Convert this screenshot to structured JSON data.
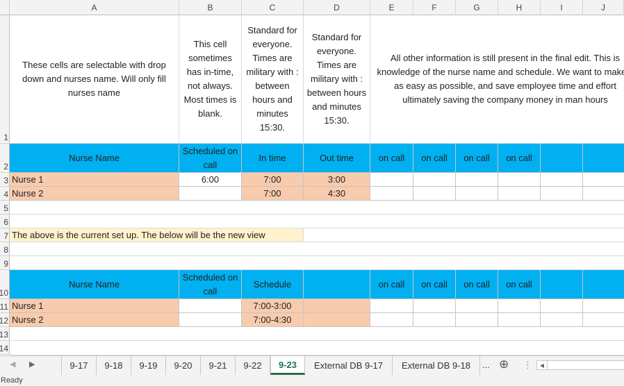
{
  "columns": [
    "A",
    "B",
    "C",
    "D",
    "E",
    "F",
    "G",
    "H",
    "I",
    "J"
  ],
  "rows": [
    "1",
    "2",
    "3",
    "4",
    "5",
    "6",
    "7",
    "8",
    "9",
    "10",
    "11",
    "12",
    "13",
    "14"
  ],
  "cells": {
    "a1": "These cells are selectable with drop down and nurses name. Will only fill nurses name",
    "b1": "This cell sometimes has in-time, not always. Most times is blank.",
    "c1": "Standard for everyone. Times are military with : between hours and minutes 15:30.",
    "d1": "Standard for everyone. Times are military with : between hours and minutes 15:30.",
    "e1": "All other information is still present in the final edit. This is knowledge of the nurse name and schedule. We want to make it as easy as possible, and save employee time and effort ultimately saving the company money in man hours",
    "a2": "Nurse Name",
    "b2": "Scheduled on call",
    "c2": "In time",
    "d2": "Out time",
    "e2": "on call",
    "f2": "on call",
    "g2": "on call",
    "h2": "on call",
    "a3": "Nurse 1",
    "b3": "6:00",
    "c3": "7:00",
    "d3": "3:00",
    "a4": "Nurse 2",
    "c4": "7:00",
    "d4": "4:30",
    "a7": "The above is the current set up. The below will be the new view",
    "a10": "Nurse Name",
    "b10": "Scheduled on call",
    "c10": "Schedule",
    "e10": "on call",
    "f10": "on call",
    "g10": "on call",
    "h10": "on call",
    "a11": "Nurse 1",
    "c11": "7:00-3:00",
    "a12": "Nurse 2",
    "c12": "7:00-4:30"
  },
  "tabs": [
    "9-17",
    "9-18",
    "9-19",
    "9-20",
    "9-21",
    "9-22",
    "9-23",
    "External DB 9-17",
    "External DB 9-18"
  ],
  "active_tab": "9-23",
  "tab_more": "...",
  "tab_add": "⊕",
  "tab_nav_prev": "◀",
  "tab_nav_next": "▶",
  "tab_menu": "⋮",
  "hscroll_left": "◀",
  "status": "Ready",
  "colors": {
    "header_blue": "#00b0f0",
    "name_peach": "#f8cbad",
    "note_yellow": "#fff2cc",
    "active_tab": "#217346"
  }
}
